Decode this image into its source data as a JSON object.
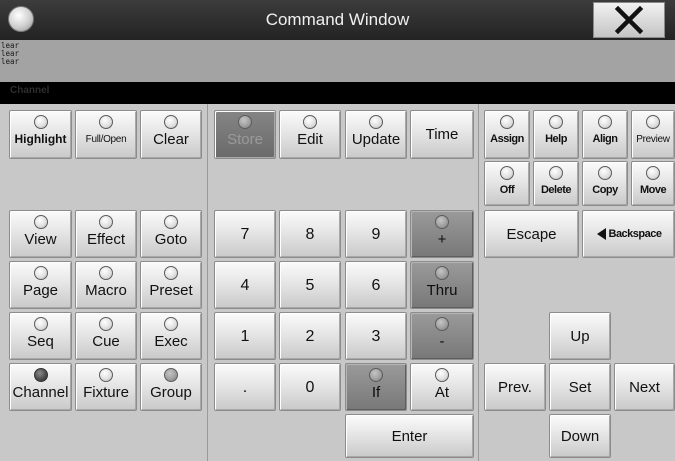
{
  "window": {
    "title": "Command Window"
  },
  "output": {
    "lines": [
      "lear",
      "lear",
      "lear"
    ]
  },
  "status": {
    "label": "Channel"
  },
  "left_panel": {
    "top_row": [
      {
        "label": "Highlight",
        "led": "off"
      },
      {
        "label": "Full/Open",
        "led": "off"
      },
      {
        "label": "Clear",
        "led": "off"
      }
    ],
    "grid": [
      {
        "label": "View",
        "led": "off"
      },
      {
        "label": "Effect",
        "led": "off"
      },
      {
        "label": "Goto",
        "led": "off"
      },
      {
        "label": "Page",
        "led": "off"
      },
      {
        "label": "Macro",
        "led": "off"
      },
      {
        "label": "Preset",
        "led": "off"
      },
      {
        "label": "Seq",
        "led": "off"
      },
      {
        "label": "Cue",
        "led": "off"
      },
      {
        "label": "Exec",
        "led": "off"
      },
      {
        "label": "Channel",
        "led": "on"
      },
      {
        "label": "Fixture",
        "led": "off"
      },
      {
        "label": "Group",
        "led": "off"
      }
    ]
  },
  "middle_panel": {
    "top_row": [
      {
        "label": "Store",
        "led": "dim"
      },
      {
        "label": "Edit",
        "led": "off"
      },
      {
        "label": "Update",
        "led": "off"
      },
      {
        "label": "Time"
      }
    ],
    "keypad": [
      "7",
      "8",
      "9",
      "+",
      "4",
      "5",
      "6",
      "Thru",
      "1",
      "2",
      "3",
      "-",
      ".",
      "0",
      "If",
      "At"
    ],
    "enter": "Enter"
  },
  "right_panel": {
    "row1": [
      "Assign",
      "Help",
      "Align",
      "Preview"
    ],
    "row2": [
      "Off",
      "Delete",
      "Copy",
      "Move"
    ],
    "escape": "Escape",
    "backspace": "Backspace",
    "nav": {
      "up": "Up",
      "prev": "Prev.",
      "set": "Set",
      "next": "Next",
      "down": "Down"
    }
  }
}
